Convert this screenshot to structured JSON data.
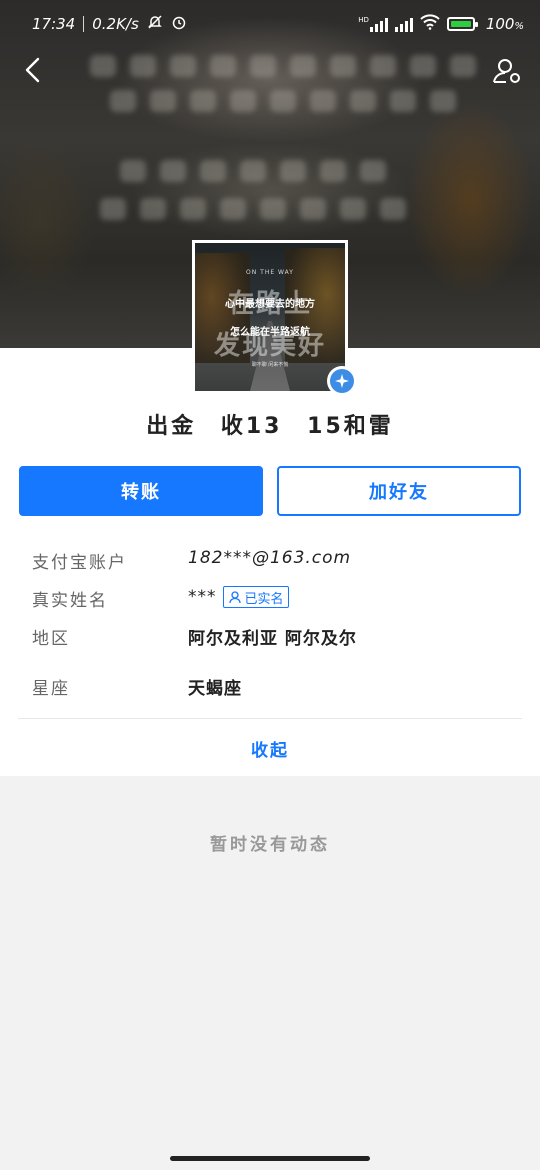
{
  "status_bar": {
    "time": "17:34",
    "net_speed": "0.2K/s",
    "battery": "100",
    "battery_unit": "%",
    "hd_label": "HD"
  },
  "nav": {
    "back_icon": "chevron-left-icon",
    "profile_icon": "user-settings-icon"
  },
  "avatar": {
    "small_caption": "ON THE WAY",
    "big_text_1": "在路上",
    "big_text_2": "发现美好",
    "line_1": "心中最想要去的地方",
    "line_2": "怎么能在半路返航",
    "footer": "聊不聊 闲来不慌"
  },
  "profile": {
    "name": "出金 收13 15和雷"
  },
  "actions": {
    "transfer": "转账",
    "add_friend": "加好友"
  },
  "info": [
    {
      "label": "支付宝账户",
      "value": "182***@163.com"
    },
    {
      "label": "真实姓名",
      "value": "***",
      "badge": "已实名"
    },
    {
      "label": "地区",
      "value": "阿尔及利亚 阿尔及尔"
    },
    {
      "label": "星座",
      "value": "天蝎座"
    }
  ],
  "collapse_label": "收起",
  "empty_text": "暂时没有动态",
  "colors": {
    "primary": "#1677ff",
    "background": "#f2f2f2"
  }
}
